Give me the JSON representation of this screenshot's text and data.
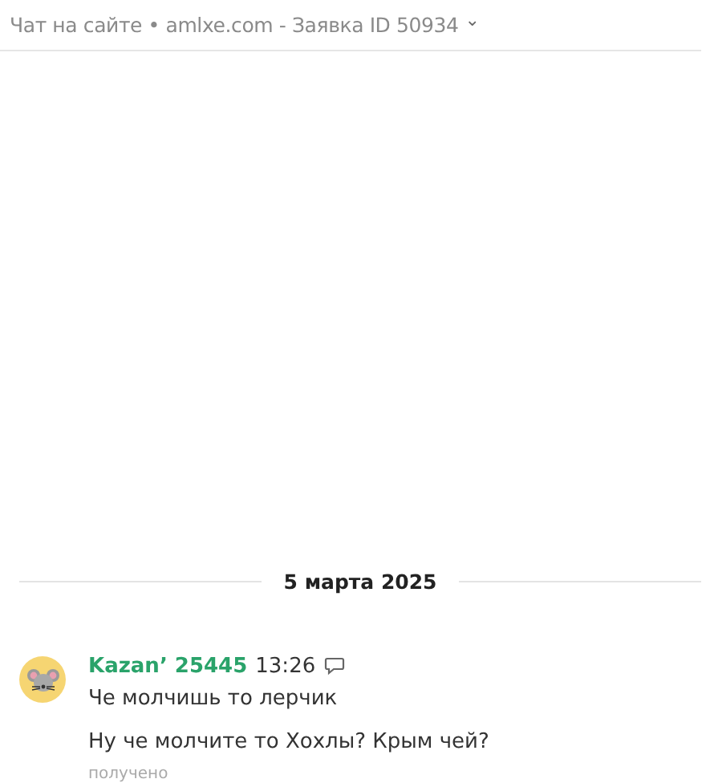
{
  "header": {
    "title": "Чат на сайте • amlxe.com - Заявка ID 50934",
    "dropdown": "⌄"
  },
  "date_separator": "5 марта 2025",
  "messages": [
    {
      "author": "Kazan’ 25445",
      "time": "13:26",
      "lines": [
        "Че молчишь то лерчик",
        "Ну че молчите то Хохлы? Крым чей?"
      ],
      "status": "получено"
    }
  ]
}
